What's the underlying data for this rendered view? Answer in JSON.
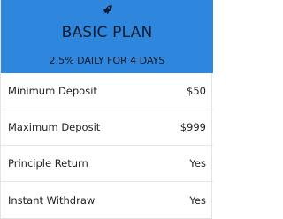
{
  "plan": {
    "icon": "rocket-icon",
    "title": "BASIC PLAN",
    "subtitle": "2.5% DAILY FOR 4 DAYS",
    "accent_color": "#2f86dd"
  },
  "features": [
    {
      "label": "Minimum Deposit",
      "value": "$50"
    },
    {
      "label": "Maximum Deposit",
      "value": "$999"
    },
    {
      "label": "Principle Return",
      "value": "Yes"
    },
    {
      "label": "Instant Withdraw",
      "value": "Yes"
    }
  ]
}
